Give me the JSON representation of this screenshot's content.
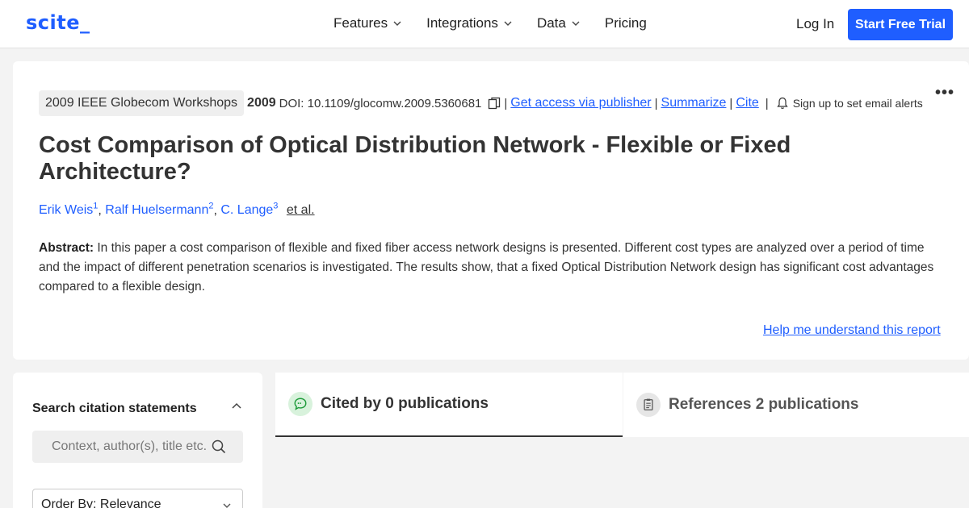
{
  "header": {
    "logo": "scite_",
    "nav": [
      {
        "label": "Features",
        "has_dropdown": true
      },
      {
        "label": "Integrations",
        "has_dropdown": true
      },
      {
        "label": "Data",
        "has_dropdown": true
      },
      {
        "label": "Pricing",
        "has_dropdown": false
      }
    ],
    "login": "Log In",
    "cta": "Start Free Trial"
  },
  "paper": {
    "venue": "2009 IEEE Globecom Workshops",
    "year": "2009",
    "doi": "DOI: 10.1109/glocomw.2009.5360681",
    "links": {
      "publisher": "Get access via publisher",
      "summarize": "Summarize",
      "cite": "Cite",
      "alerts": "Sign up to set email alerts"
    },
    "more": "•••",
    "title": "Cost Comparison of Optical Distribution Network - Flexible or Fixed Architecture?",
    "authors": [
      {
        "name": "Erik Weis",
        "sup": "1"
      },
      {
        "name": "Ralf Huelsermann",
        "sup": "2"
      },
      {
        "name": "C. Lange",
        "sup": "3"
      }
    ],
    "etal": "et al.",
    "abstract_label": "Abstract:",
    "abstract": "In this paper a cost comparison of flexible and fixed fiber access network designs is presented. Different cost types are analyzed over a period of time and the impact of different penetration scenarios is investigated. The results show, that a fixed Optical Distribution Network design has significant cost advantages compared to a flexible design.",
    "help_link": "Help me understand this report"
  },
  "sidebar": {
    "title": "Search citation statements",
    "search_placeholder": "Context, author(s), title etc.",
    "order_by": "Order By: Relevance"
  },
  "tabs": [
    {
      "label": "Cited by 0 publications",
      "icon": "speech-bubble-icon",
      "active": true
    },
    {
      "label": "References 2 publications",
      "icon": "document-icon",
      "active": false
    }
  ],
  "colors": {
    "accent": "#1f5eff",
    "cited_icon_bg": "#d8f2dc",
    "cited_icon_fg": "#1e9b3a"
  }
}
